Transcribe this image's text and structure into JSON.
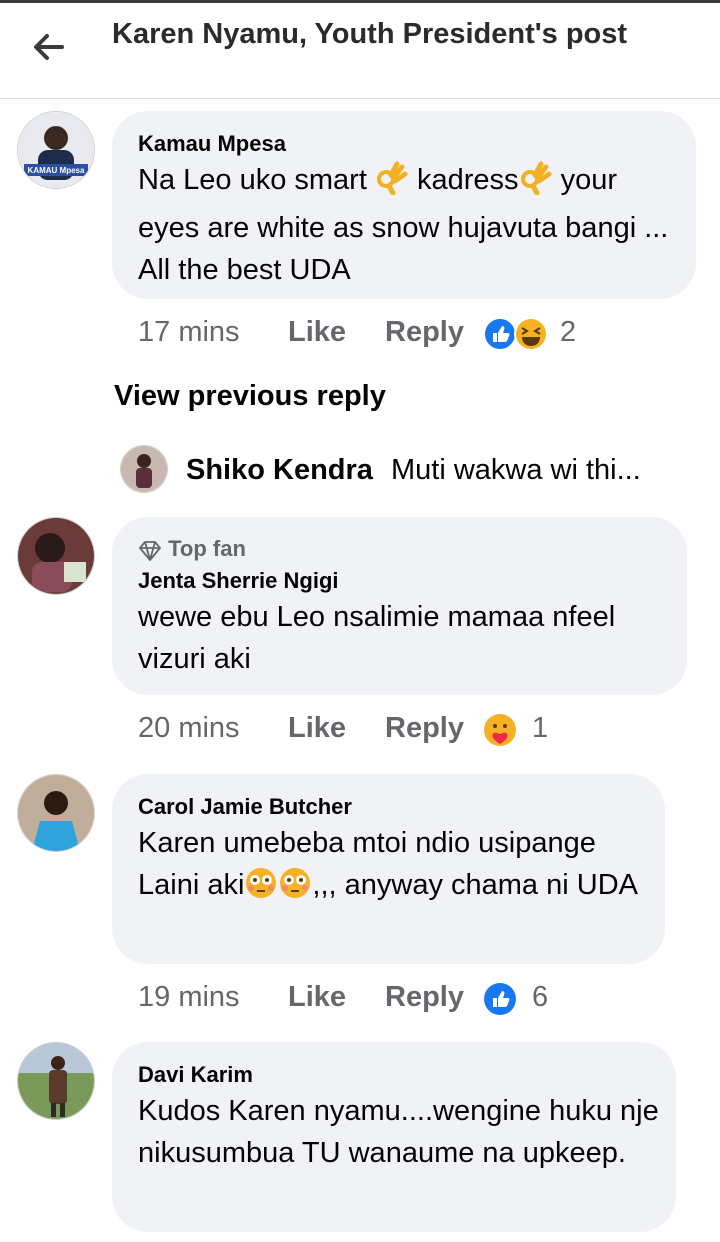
{
  "header": {
    "title": "Karen Nyamu, Youth President's post"
  },
  "comments": [
    {
      "author": "Kamau Mpesa",
      "text_parts": [
        "Na Leo uko smart ",
        " kadress",
        " your eyes are white as snow hujavuta bangi ... All the best UDA"
      ],
      "emoji_icons": [
        "ok-hand-icon",
        "ok-hand-icon"
      ],
      "time": "17 mins",
      "like": "Like",
      "reply": "Reply",
      "reactions": [
        "like-reaction-icon",
        "haha-reaction-icon"
      ],
      "reaction_count": "2",
      "avatar_label": "KAMAU Mpesa"
    },
    {
      "top_fan": "Top fan",
      "author": "Jenta Sherrie Ngigi",
      "text": "wewe ebu Leo nsalimie mamaa nfeel vizuri aki",
      "time": "20 mins",
      "like": "Like",
      "reply": "Reply",
      "reactions": [
        "care-reaction-icon"
      ],
      "reaction_count": "1"
    },
    {
      "author": "Carol Jamie Butcher",
      "text_parts": [
        "Karen umebeba mtoi ndio usipange Laini aki",
        ",,, anyway chama ni UDA"
      ],
      "emoji_icons": [
        "flushed-face-icon",
        "flushed-face-icon"
      ],
      "time": "19 mins",
      "like": "Like",
      "reply": "Reply",
      "reactions": [
        "like-reaction-icon"
      ],
      "reaction_count": "6"
    },
    {
      "author": "Davi Karim",
      "text": "Kudos Karen nyamu....wengine huku nje nikusumbua TU wanaume na upkeep."
    }
  ],
  "view_previous": "View previous reply",
  "reply_preview": {
    "author": "Shiko Kendra",
    "text": "Muti wakwa wi thi..."
  },
  "colors": {
    "bubble": "#f0f2f5",
    "meta": "#65676b",
    "like_blue": "#1877f2",
    "haha_yellow": "#f7b125"
  }
}
